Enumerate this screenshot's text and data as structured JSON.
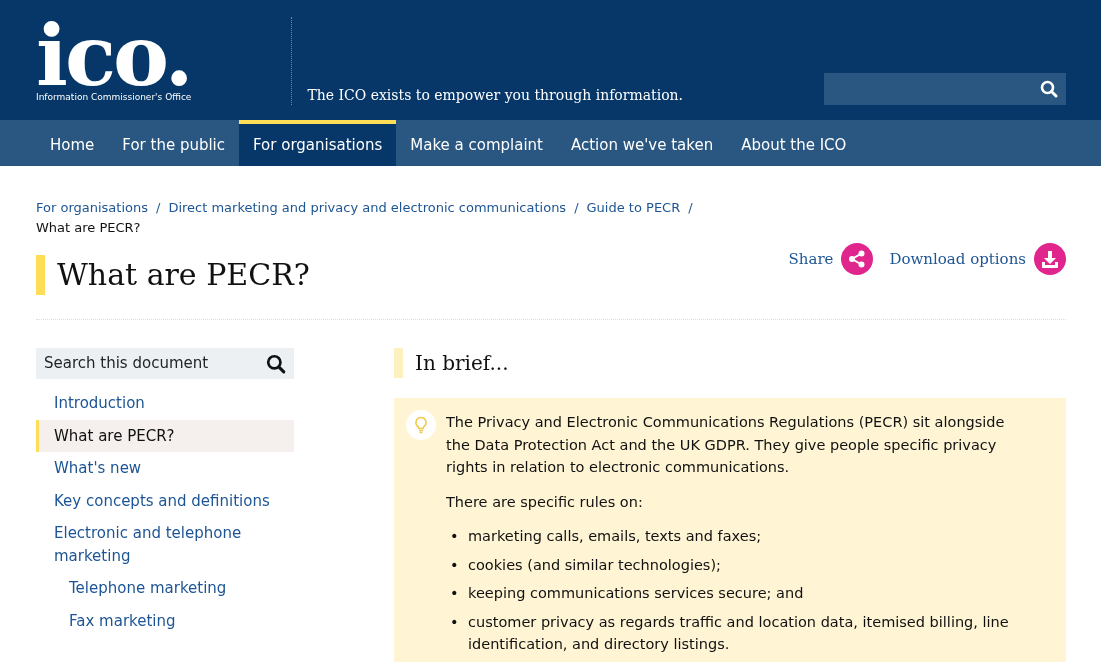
{
  "header": {
    "logo_text": "ico.",
    "logo_subtitle": "Information Commissioner's Office",
    "tagline": "The ICO exists to empower you through information."
  },
  "nav": [
    {
      "label": "Home",
      "selected": false
    },
    {
      "label": "For the public",
      "selected": false
    },
    {
      "label": "For organisations",
      "selected": true
    },
    {
      "label": "Make a complaint",
      "selected": false
    },
    {
      "label": "Action we've taken",
      "selected": false
    },
    {
      "label": "About the ICO",
      "selected": false
    }
  ],
  "breadcrumbs": [
    {
      "label": "For organisations",
      "separator": "/"
    },
    {
      "label": "Direct marketing and privacy and electronic communications",
      "separator": "/"
    },
    {
      "label": "Guide to PECR",
      "separator": "/"
    }
  ],
  "current_page": "What are PECR?",
  "page_title": "What are PECR?",
  "actions": [
    {
      "label": "Share",
      "kind": "share"
    },
    {
      "label": "Download options",
      "kind": "download"
    }
  ],
  "sidebar": {
    "search_placeholder": "Search this document",
    "items": [
      {
        "label": "Introduction",
        "selected": false
      },
      {
        "label": "What are PECR?",
        "selected": true
      },
      {
        "label": "What's new",
        "selected": false
      },
      {
        "label": "Key concepts and definitions",
        "selected": false
      },
      {
        "label": "Electronic and telephone marketing",
        "selected": false,
        "children": [
          {
            "label": "Telephone marketing",
            "selected": false
          },
          {
            "label": "Fax marketing",
            "selected": false
          }
        ]
      }
    ]
  },
  "section_title": "In brief...",
  "brief": {
    "paragraphs": [
      "The Privacy and Electronic Communications Regulations (PECR) sit alongside the Data Protection Act and the UK GDPR. They give people specific privacy rights in relation to electronic communications.",
      "There are specific rules on:"
    ],
    "bullets": [
      {
        "marker": "•",
        "text": "marketing calls, emails, texts and faxes;"
      },
      {
        "marker": "•",
        "text": "cookies (and similar technologies);"
      },
      {
        "marker": "•",
        "text": "keeping communications services secure; and"
      },
      {
        "marker": "•",
        "text": "customer privacy as regards traffic and location data, itemised billing, line identification, and directory listings."
      }
    ]
  }
}
